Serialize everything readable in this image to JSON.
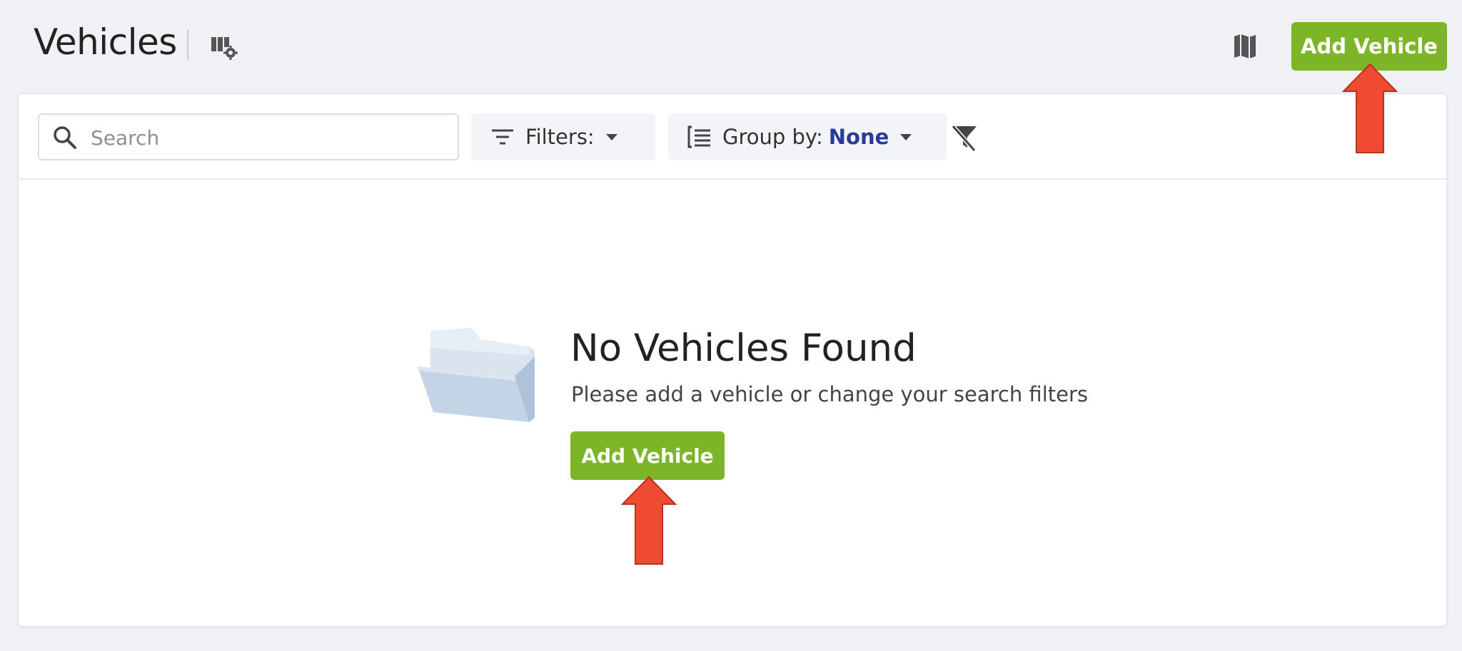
{
  "header": {
    "title": "Vehicles",
    "add_button": "Add Vehicle",
    "icons": [
      "vehicle-settings-icon",
      "map-icon"
    ]
  },
  "toolbar": {
    "search_placeholder": "Search",
    "filters_label": "Filters:",
    "group_by_label": "Group by:",
    "group_by_value": "None",
    "icons": [
      "search-icon",
      "filter-lines-icon",
      "caret-down-icon",
      "group-list-icon",
      "clear-filter-icon"
    ]
  },
  "empty_state": {
    "title": "No Vehicles Found",
    "subtitle": "Please add a vehicle or change your search filters",
    "add_button": "Add Vehicle",
    "icon": "folder-icon"
  },
  "colors": {
    "accent_green": "#7db529",
    "group_value_blue": "#2a3b99",
    "annotation_red": "#ef4a32"
  }
}
